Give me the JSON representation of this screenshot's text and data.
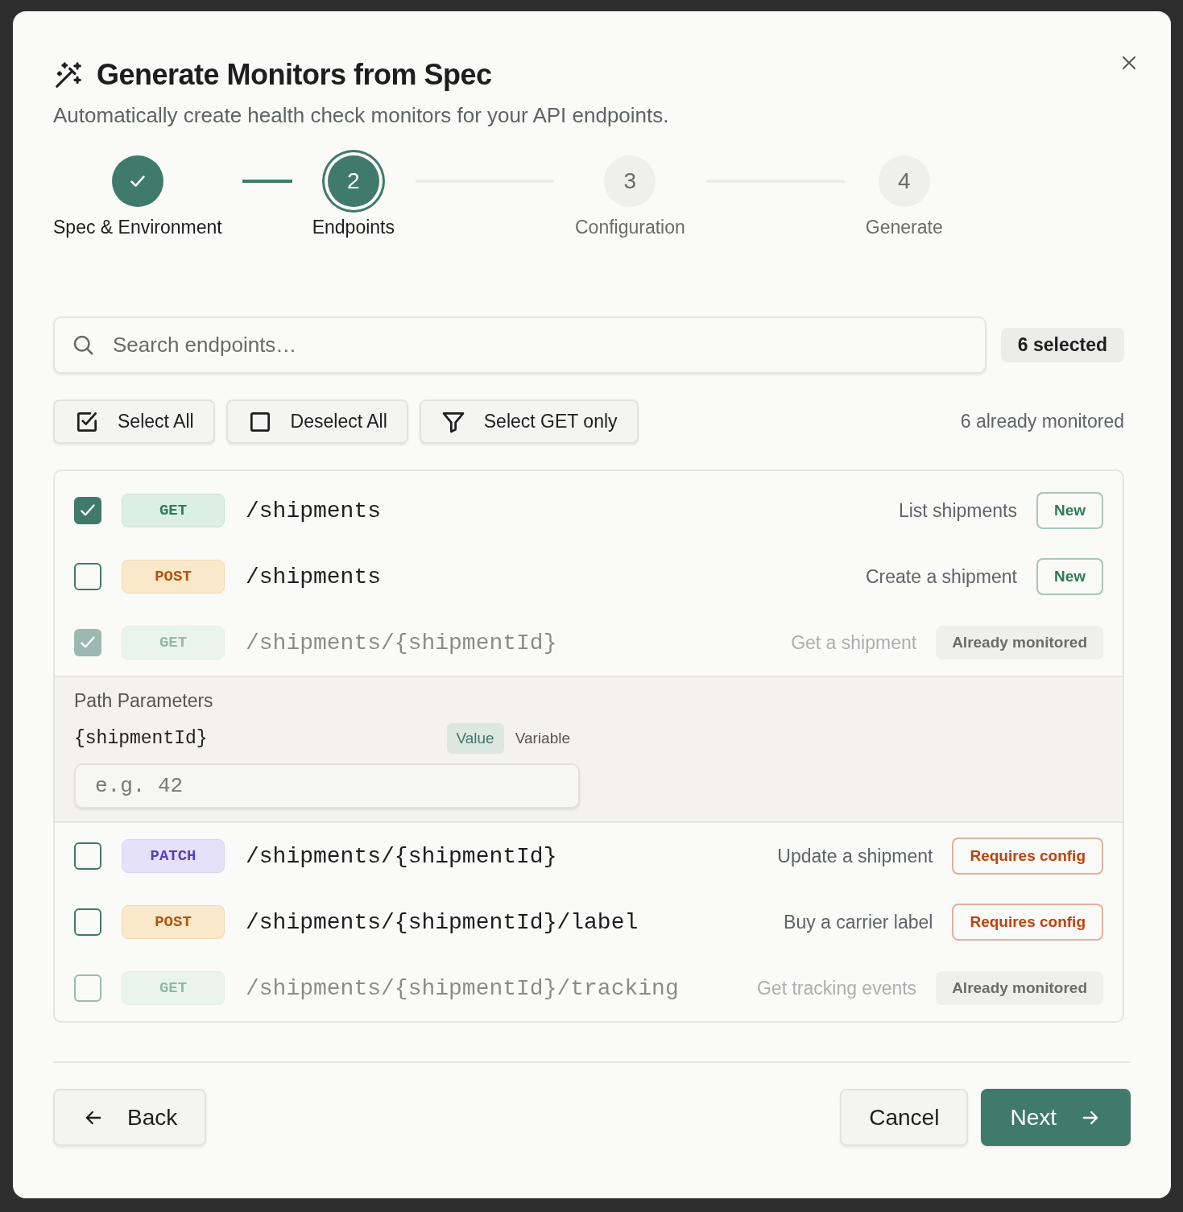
{
  "dialog": {
    "title": "Generate Monitors from Spec",
    "subtitle": "Automatically create health check monitors for your API endpoints."
  },
  "steps": [
    {
      "label": "Spec & Environment",
      "completed": true,
      "selected": false
    },
    {
      "number": "2",
      "label": "Endpoints",
      "completed": false,
      "selected": true
    },
    {
      "number": "3",
      "label": "Configuration",
      "completed": false,
      "selected": false
    },
    {
      "number": "4",
      "label": "Generate",
      "completed": false,
      "selected": false
    }
  ],
  "search": {
    "placeholder": "Search endpoints…"
  },
  "selected_count": "6 selected",
  "actions": [
    {
      "label": "Select All",
      "kind": "select-all"
    },
    {
      "label": "Deselect All",
      "kind": "deselect-all"
    },
    {
      "label": "Select GET only",
      "kind": "filter"
    }
  ],
  "monitored_note": "6 already monitored",
  "endpoints": [
    {
      "method": "GET",
      "path": "/shipments",
      "summary": "List shipments",
      "badge": "New",
      "color": "#2f7a57",
      "checked": true,
      "disabled": false
    },
    {
      "method": "POST",
      "path": "/shipments",
      "summary": "Create a shipment",
      "badge": "New",
      "color": "#2f7a57",
      "checked": false,
      "disabled": false
    },
    {
      "method": "GET",
      "path": "/shipments/{shipmentId}",
      "summary": "Get a shipment",
      "badge": "Already monitored",
      "color": "#6b6b6b",
      "checked": true,
      "disabled": true,
      "params": {
        "title": "Path Parameters",
        "items": [
          {
            "name": "{shipmentId}",
            "modes": [
              {
                "label": "Value",
                "selected": true
              },
              {
                "label": "Variable",
                "selected": false
              }
            ],
            "placeholder": "e.g. 42"
          }
        ]
      }
    },
    {
      "method": "PATCH",
      "path": "/shipments/{shipmentId}",
      "summary": "Update a shipment",
      "badge": "Requires config",
      "color": "#c2410c",
      "checked": false,
      "disabled": false
    },
    {
      "method": "POST",
      "path": "/shipments/{shipmentId}/label",
      "summary": "Buy a carrier label",
      "badge": "Requires config",
      "color": "#c2410c",
      "checked": false,
      "disabled": false
    },
    {
      "method": "GET",
      "path": "/shipments/{shipmentId}/tracking",
      "summary": "Get tracking events",
      "badge": "Already monitored",
      "color": "#6b6b6b",
      "checked": false,
      "disabled": true
    }
  ],
  "footer": {
    "back": "Back",
    "cancel": "Cancel",
    "next": "Next"
  }
}
